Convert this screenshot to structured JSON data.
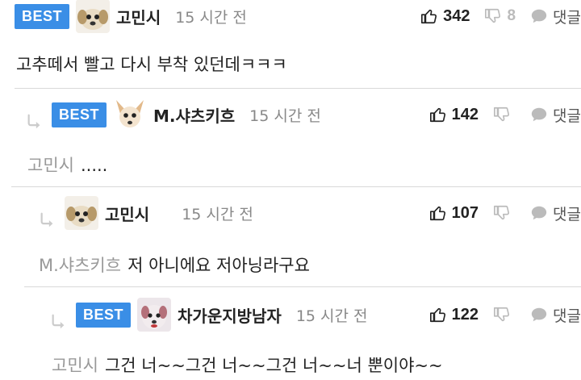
{
  "comments": [
    {
      "badge": "BEST",
      "nickname": "고민시",
      "time": "15 시간 전",
      "likes": "342",
      "dislikes": "8",
      "reply_label": "댓글",
      "mention": "",
      "text": "고추떼서 빨고 다시 부착 있던데ㅋㅋㅋ",
      "avatar_icon": "puppy-avatar-icon"
    },
    {
      "badge": "BEST",
      "nickname": "M.샤츠키흐",
      "time": "15 시간 전",
      "likes": "142",
      "dislikes": "",
      "reply_label": "댓글",
      "mention": "고민시",
      "text": ".....",
      "avatar_icon": "chihuahua-avatar-icon"
    },
    {
      "badge": "",
      "nickname": "고민시",
      "time": "15 시간 전",
      "likes": "107",
      "dislikes": "",
      "reply_label": "댓글",
      "mention": "M.샤츠키흐",
      "text": "저 아니에요 저아닝라구요",
      "avatar_icon": "puppy-avatar-icon"
    },
    {
      "badge": "BEST",
      "nickname": "차가운지방남자",
      "time": "15 시간 전",
      "likes": "122",
      "dislikes": "",
      "reply_label": "댓글",
      "mention": "고민시",
      "text": "그건 너~~그건 너~~그건 너~~너 뿐이야~~",
      "avatar_icon": "dog-avatar-icon"
    }
  ],
  "colors": {
    "badge": "#3a8ee6",
    "muted": "#999999",
    "divider": "#d9d9d9"
  }
}
